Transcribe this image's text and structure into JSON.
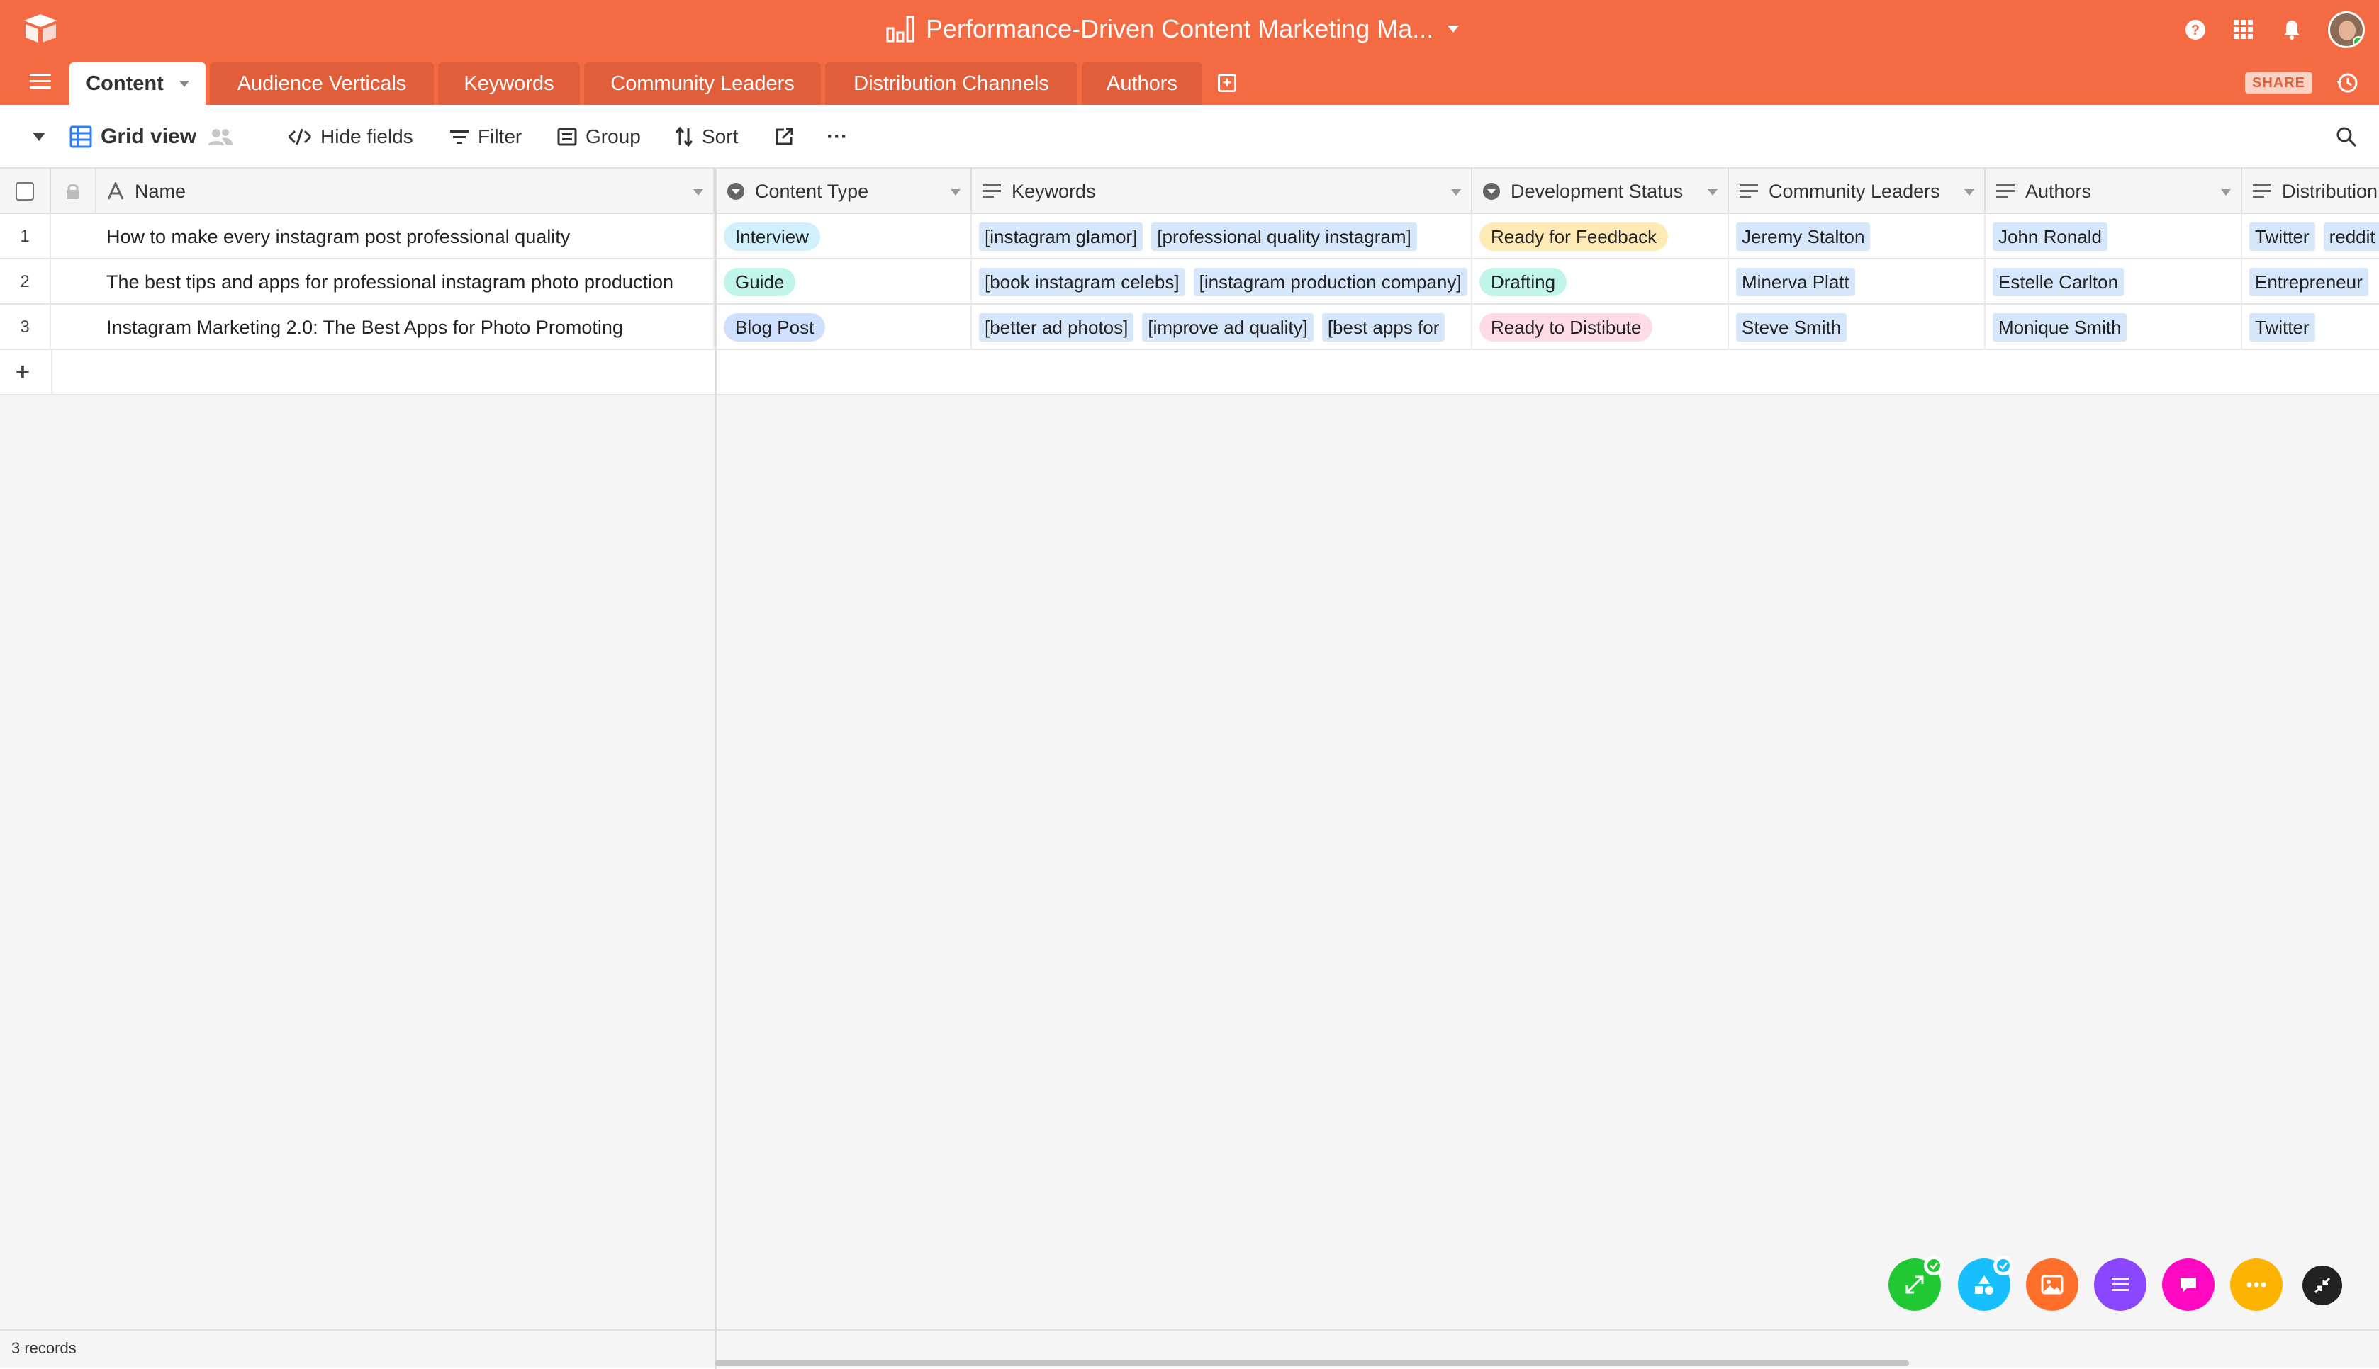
{
  "app": {
    "base_title": "Performance-Driven Content Marketing Ma...",
    "share_label": "SHARE"
  },
  "tables": [
    {
      "label": "Content"
    },
    {
      "label": "Audience Verticals"
    },
    {
      "label": "Keywords"
    },
    {
      "label": "Community Leaders"
    },
    {
      "label": "Distribution Channels"
    },
    {
      "label": "Authors"
    }
  ],
  "toolbar": {
    "view_name": "Grid view",
    "hide_fields": "Hide fields",
    "filter": "Filter",
    "group": "Group",
    "sort": "Sort",
    "more": "···"
  },
  "columns": {
    "name": "Name",
    "content_type": "Content Type",
    "keywords": "Keywords",
    "development_status": "Development Status",
    "community_leaders": "Community Leaders",
    "authors": "Authors",
    "distribution": "Distribution"
  },
  "rows": [
    {
      "num": "1",
      "name": "How to make every instagram post professional quality",
      "content_type": "Interview",
      "keywords": [
        "[instagram glamor]",
        "[professional quality instagram]"
      ],
      "status": "Ready for Feedback",
      "leader": "Jeremy Stalton",
      "author": "John Ronald",
      "distribution": [
        "Twitter",
        "reddit"
      ]
    },
    {
      "num": "2",
      "name": "The best tips and apps for professional instagram photo production",
      "content_type": "Guide",
      "keywords": [
        "[book instagram celebs]",
        "[instagram production company]"
      ],
      "status": "Drafting",
      "leader": "Minerva Platt",
      "author": "Estelle Carlton",
      "distribution": [
        "Entrepreneur"
      ]
    },
    {
      "num": "3",
      "name": "Instagram Marketing 2.0: The Best Apps for Photo Promoting",
      "content_type": "Blog Post",
      "keywords": [
        "[better ad photos]",
        "[improve ad quality]",
        "[best apps for"
      ],
      "status": "Ready to Distibute",
      "leader": "Steve Smith",
      "author": "Monique Smith",
      "distribution": [
        "Twitter"
      ]
    }
  ],
  "add_row": "+",
  "footer": {
    "record_count": "3 records"
  },
  "colors": {
    "brand": "#f46a43",
    "tab_inactive": "#e15e3b",
    "pill_interview": "#d0f0fd",
    "pill_guide": "#c2f5e9",
    "pill_blog": "#cfdfff",
    "status_feedback": "#ffeab6",
    "status_drafting": "#c2f5e9",
    "status_distribute": "#ffdce5",
    "linked_record": "#d6e6fb"
  },
  "floating_apps": [
    {
      "icon": "expand-arrows-icon",
      "color": "#20c933"
    },
    {
      "icon": "shapes-icon",
      "color": "#18bfff"
    },
    {
      "icon": "image-icon",
      "color": "#ff6f2c"
    },
    {
      "icon": "list-icon",
      "color": "#8b46ff"
    },
    {
      "icon": "chat-icon",
      "color": "#ff08c2"
    },
    {
      "icon": "more-icon",
      "color": "#fcb400"
    },
    {
      "icon": "collapse-icon",
      "color": "#333333"
    }
  ]
}
